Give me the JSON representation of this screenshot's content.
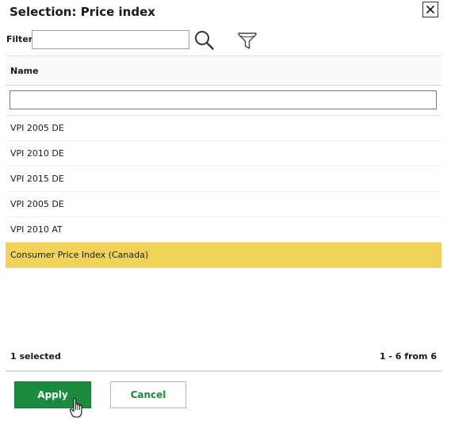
{
  "dialog": {
    "title": "Selection: Price index",
    "close_icon": "close-icon"
  },
  "filter": {
    "label": "Filter",
    "value": "",
    "placeholder": "",
    "search_icon": "search-icon",
    "funnel_icon": "funnel-icon"
  },
  "grid": {
    "columns": [
      "Name"
    ],
    "column_filter_value": "",
    "rows": [
      {
        "name": "VPI 2005 DE",
        "selected": false
      },
      {
        "name": "VPI 2010 DE",
        "selected": false
      },
      {
        "name": "VPI 2015 DE",
        "selected": false
      },
      {
        "name": "VPI 2005 DE",
        "selected": false
      },
      {
        "name": "VPI 2010 AT",
        "selected": false
      },
      {
        "name": "Consumer Price Index (Canada)",
        "selected": true
      }
    ]
  },
  "footer": {
    "selected_count": "1 selected",
    "pagination": "1 - 6 from 6"
  },
  "actions": {
    "apply_label": "Apply",
    "cancel_label": "Cancel"
  },
  "colors": {
    "selection_highlight": "#f2d35a",
    "apply_bg": "#1c8a3e",
    "cancel_text": "#1c8a3e"
  }
}
